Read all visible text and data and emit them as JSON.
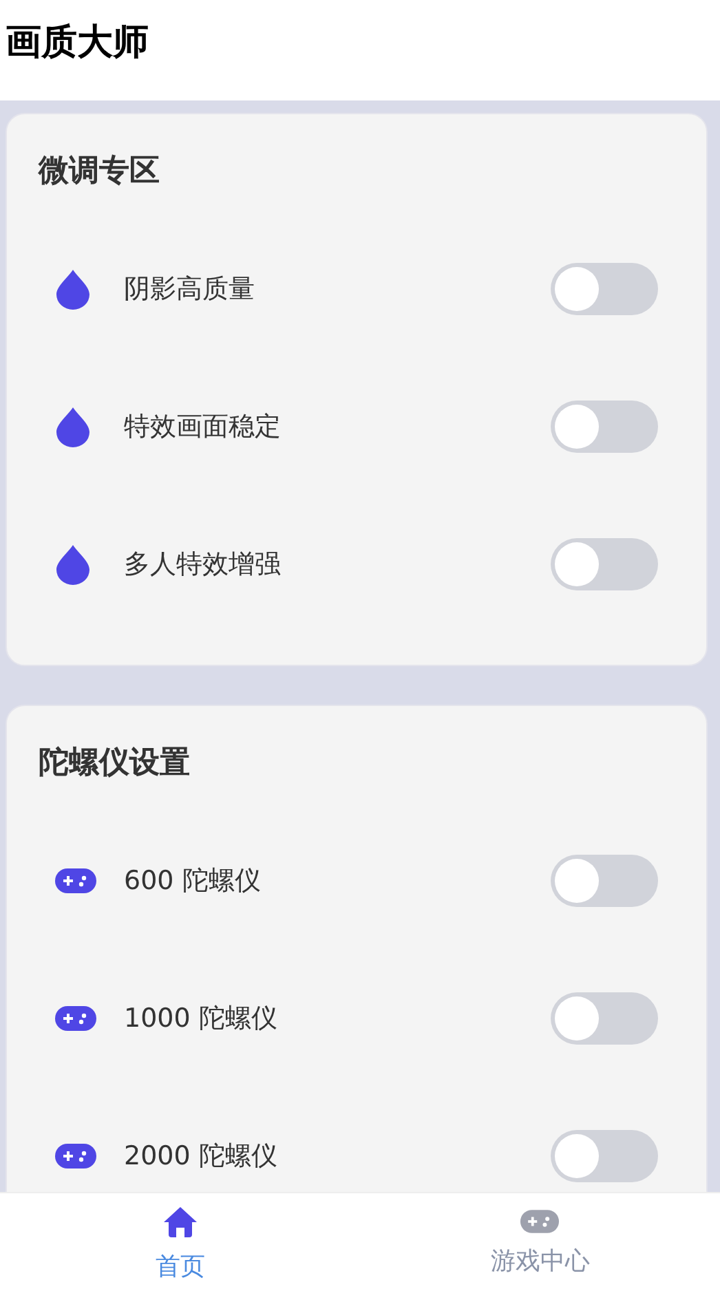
{
  "header": {
    "title": "画质大师"
  },
  "sections": [
    {
      "title": "微调专区",
      "items": [
        {
          "kind": "drop",
          "label": "阴影高质量",
          "on": false
        },
        {
          "kind": "drop",
          "label": "特效画面稳定",
          "on": false
        },
        {
          "kind": "drop",
          "label": "多人特效增强",
          "on": false
        }
      ]
    },
    {
      "title": "陀螺仪设置",
      "items": [
        {
          "kind": "gamepad",
          "label": "600 陀螺仪",
          "on": false
        },
        {
          "kind": "gamepad",
          "label": "1000 陀螺仪",
          "on": false
        },
        {
          "kind": "gamepad",
          "label": "2000 陀螺仪",
          "on": false
        }
      ]
    }
  ],
  "tab_bar": [
    {
      "kind": "home",
      "label": "首页",
      "selected": true
    },
    {
      "kind": "gamepad",
      "label": "游戏中心",
      "selected": false
    }
  ]
}
